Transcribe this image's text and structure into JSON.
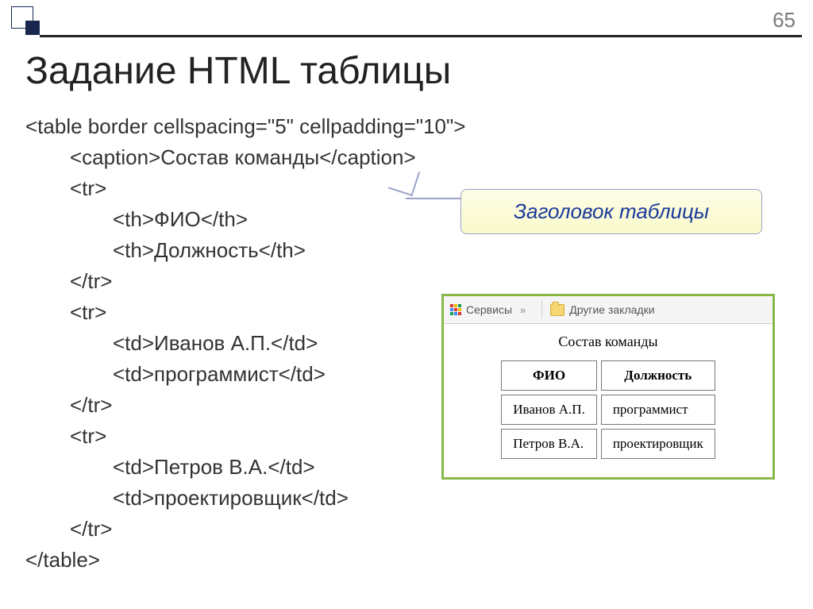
{
  "page_number": "65",
  "title": "Задание HTML таблицы",
  "code": {
    "l1": "<table border cellspacing=\"5\" cellpadding=\"10\">",
    "l2": "<caption>Состав команды</caption>",
    "l3": "<tr>",
    "l4": "<th>ФИО</th>",
    "l5": "<th>Должность</th>",
    "l6": "</tr>",
    "l7": "<tr>",
    "l8": "<td>Иванов А.П.</td>",
    "l9": "<td>программист</td>",
    "l10": "</tr>",
    "l11": "<tr>",
    "l12": "<td>Петров В.А.</td>",
    "l13": "<td>проектировщик</td>",
    "l14": "</tr>",
    "l15": "</table>"
  },
  "callout": "Заголовок таблицы",
  "browser": {
    "services": "Сервисы",
    "chevrons": "»",
    "bookmarks": "Другие закладки",
    "caption": "Состав команды",
    "th1": "ФИО",
    "th2": "Должность",
    "r1c1": "Иванов А.П.",
    "r1c2": "программист",
    "r2c1": "Петров В.А.",
    "r2c2": "проектировщик"
  }
}
